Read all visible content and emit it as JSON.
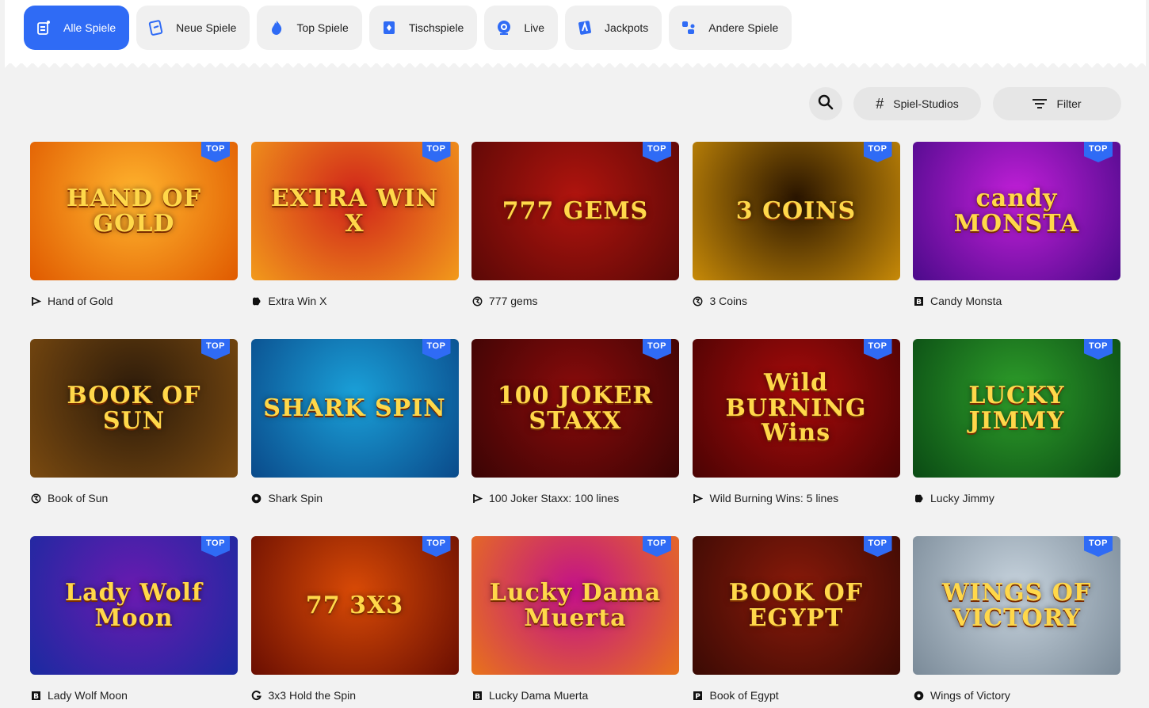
{
  "categories": [
    {
      "label": "Alle Spiele",
      "icon": "all-games-icon",
      "active": true
    },
    {
      "label": "Neue Spiele",
      "icon": "new-games-icon",
      "active": false
    },
    {
      "label": "Top Spiele",
      "icon": "flame-icon",
      "active": false
    },
    {
      "label": "Tischspiele",
      "icon": "card-icon",
      "active": false
    },
    {
      "label": "Live",
      "icon": "live-icon",
      "active": false
    },
    {
      "label": "Jackpots",
      "icon": "jackpot-icon",
      "active": false
    },
    {
      "label": "Andere Spiele",
      "icon": "other-games-icon",
      "active": false
    }
  ],
  "toolbar": {
    "search_icon": "search-icon",
    "studios_label": "Spiel-Studios",
    "filter_label": "Filter"
  },
  "badge_text": "TOP",
  "games": [
    {
      "name": "Hand of Gold",
      "thumb_title": "HAND OF GOLD",
      "provider_icon": "flag-icon",
      "bg": [
        "#ffb52e",
        "#e05a00"
      ],
      "top": true
    },
    {
      "name": "Extra Win X",
      "thumb_title": "EXTRA WIN X",
      "provider_icon": "puzzle-icon",
      "bg": [
        "#d0241a",
        "#f29a1b"
      ],
      "top": true
    },
    {
      "name": "777 gems",
      "thumb_title": "777 GEMS",
      "provider_icon": "spiral-icon",
      "bg": [
        "#b0140e",
        "#5a0806"
      ],
      "top": true
    },
    {
      "name": "3 Coins",
      "thumb_title": "3 COINS",
      "provider_icon": "spiral-icon",
      "bg": [
        "#2a1500",
        "#c78a08"
      ],
      "top": true
    },
    {
      "name": "Candy Monsta",
      "thumb_title": "candy MONSTA",
      "provider_icon": "b-square-icon",
      "bg": [
        "#c21fd8",
        "#4b0a8a"
      ],
      "top": true
    },
    {
      "name": "Book of Sun",
      "thumb_title": "BOOK OF SUN",
      "provider_icon": "spiral-icon",
      "bg": [
        "#2b1a0a",
        "#7a4a10"
      ],
      "top": true
    },
    {
      "name": "Shark Spin",
      "thumb_title": "SHARK SPIN",
      "provider_icon": "circle-dot-icon",
      "bg": [
        "#1aa0d8",
        "#0a4a8a"
      ],
      "top": true
    },
    {
      "name": "100 Joker Staxx: 100 lines",
      "thumb_title": "100 JOKER STAXX",
      "provider_icon": "flag-icon",
      "bg": [
        "#8a0b0b",
        "#3a0404"
      ],
      "top": true
    },
    {
      "name": "Wild Burning Wins: 5 lines",
      "thumb_title": "Wild BURNING Wins",
      "provider_icon": "flag-icon",
      "bg": [
        "#a80b0b",
        "#4a0303"
      ],
      "top": true
    },
    {
      "name": "Lucky Jimmy",
      "thumb_title": "LUCKY JIMMY",
      "provider_icon": "puzzle-icon",
      "bg": [
        "#2e9e2a",
        "#0a4a14"
      ],
      "top": true
    },
    {
      "name": "Lady Wolf Moon",
      "thumb_title": "Lady Wolf Moon",
      "provider_icon": "b-square-icon",
      "bg": [
        "#6a1ab0",
        "#1a2aa0"
      ],
      "top": true
    },
    {
      "name": "3x3 Hold the Spin",
      "thumb_title": "77 3X3",
      "provider_icon": "g-icon",
      "bg": [
        "#d84a06",
        "#6a0e02"
      ],
      "top": true
    },
    {
      "name": "Lucky Dama Muerta",
      "thumb_title": "Lucky Dama Muerta",
      "provider_icon": "b-square-icon",
      "bg": [
        "#c2108a",
        "#e8731a"
      ],
      "top": true
    },
    {
      "name": "Book of Egypt",
      "thumb_title": "BOOK OF EGYPT",
      "provider_icon": "p-square-icon",
      "bg": [
        "#8a1a0a",
        "#3a0a04"
      ],
      "top": true
    },
    {
      "name": "Wings of Victory",
      "thumb_title": "WINGS OF VICTORY",
      "provider_icon": "circle-dot-icon",
      "bg": [
        "#c8d4de",
        "#7a8a98"
      ],
      "top": true
    }
  ]
}
